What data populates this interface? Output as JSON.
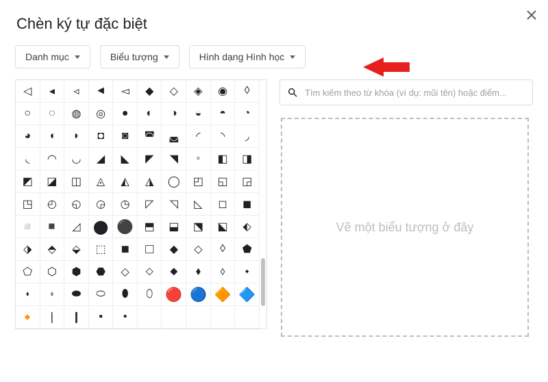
{
  "title": "Chèn ký tự đặc biệt",
  "dropdowns": {
    "category": "Danh mục",
    "subcategory": "Biểu tượng",
    "shapes": "Hình dạng Hình học"
  },
  "search": {
    "placeholder": "Tìm kiếm theo từ khóa (ví dụ: mũi tên) hoặc điểm..."
  },
  "drawbox": "Vẽ một biểu tượng ở đây",
  "grid": [
    [
      "◁",
      "◂",
      "◃",
      "◄",
      "◅",
      "◆",
      "◇",
      "◈",
      "◉",
      "◊"
    ],
    [
      "○",
      "◌",
      "◍",
      "◎",
      "●",
      "◐",
      "◑",
      "◒",
      "◓",
      "◔"
    ],
    [
      "◕",
      "◖",
      "◗",
      "◘",
      "◙",
      "◚",
      "◛",
      "◜",
      "◝",
      "◞"
    ],
    [
      "◟",
      "◠",
      "◡",
      "◢",
      "◣",
      "◤",
      "◥",
      "◦",
      "◧",
      "◨"
    ],
    [
      "◩",
      "◪",
      "◫",
      "◬",
      "◭",
      "◮",
      "◯",
      "◰",
      "◱",
      "◲"
    ],
    [
      "◳",
      "◴",
      "◵",
      "◶",
      "◷",
      "◸",
      "◹",
      "◺",
      "◻",
      "◼"
    ],
    [
      "◽",
      "◾",
      "◿",
      "⬤",
      "⚫",
      "⬒",
      "⬓",
      "⬔",
      "⬕",
      "⬖"
    ],
    [
      "⬗",
      "⬘",
      "⬙",
      "⬚",
      "■",
      "□",
      "◆",
      "◇",
      "◊",
      "⬟"
    ],
    [
      "⬠",
      "⬡",
      "⬢",
      "⬣",
      "◇",
      "⬦",
      "⬥",
      "⬧",
      "⬨",
      "⬩"
    ],
    [
      "⬪",
      "⬫",
      "⬬",
      "⬭",
      "⬮",
      "⬯",
      "🔴",
      "🔵",
      "🔶",
      "🔷"
    ],
    [
      "🔸",
      "❘",
      "❙",
      "▪",
      "•",
      "",
      "",
      "",
      "",
      ""
    ]
  ],
  "colors": {
    "red": "#e53935",
    "blue": "#1e88e5",
    "orange": "#fb8c00",
    "darkblue": "#1565c0"
  }
}
